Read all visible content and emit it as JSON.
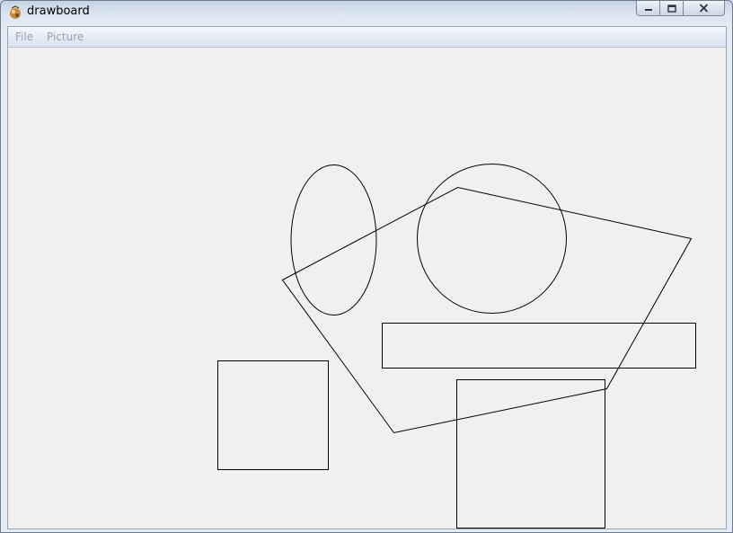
{
  "window": {
    "title": "drawboard",
    "controls": {
      "minimize_icon": "minimize-icon",
      "maximize_icon": "maximize-icon",
      "close_icon": "close-icon"
    }
  },
  "menu": {
    "items": [
      {
        "label": "File"
      },
      {
        "label": "Picture"
      }
    ]
  },
  "canvas": {
    "stroke_color": "#000000",
    "background_color": "#f0f0f0",
    "shapes": [
      {
        "type": "ellipse"
      },
      {
        "type": "circle"
      },
      {
        "type": "polygon"
      },
      {
        "type": "rectangle"
      },
      {
        "type": "rectangle"
      },
      {
        "type": "rectangle"
      }
    ]
  }
}
